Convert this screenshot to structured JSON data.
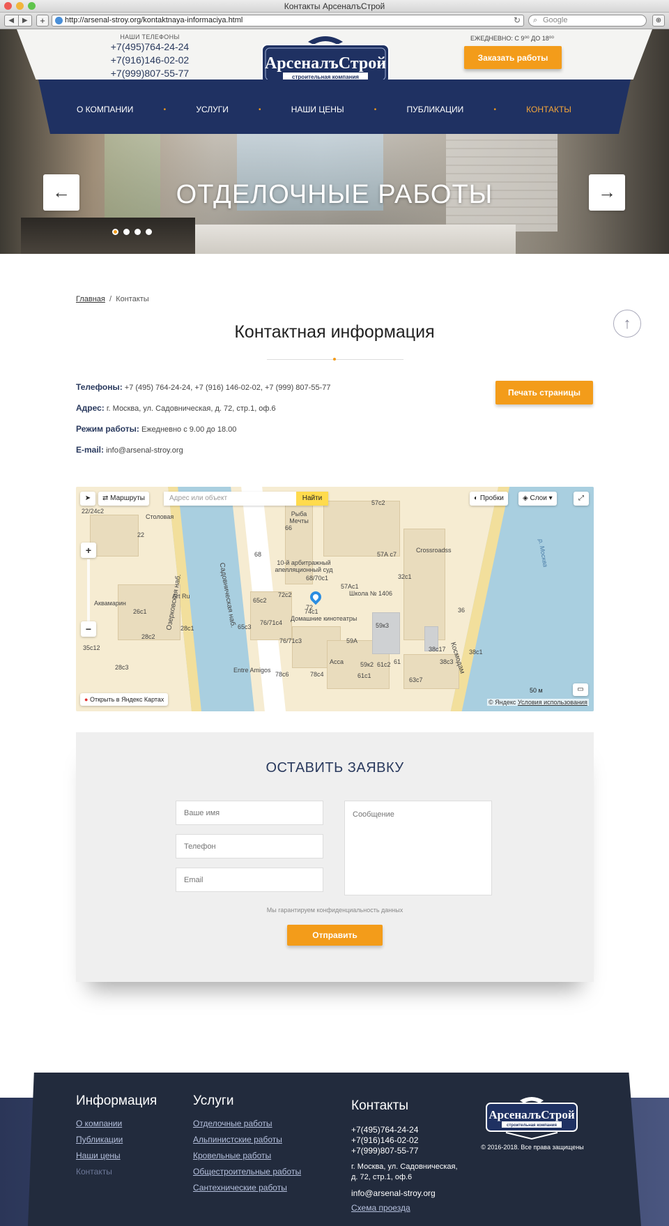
{
  "browser": {
    "window_title": "Контакты АрсеналъСтрой",
    "url": "http://arsenal-stroy.org/kontaktnaya-informaciya.html",
    "search_placeholder": "Google"
  },
  "header": {
    "phones_label": "НАШИ ТЕЛЕФОНЫ",
    "phones": [
      "+7(495)764-24-24",
      "+7(916)146-02-02",
      "+7(999)807-55-77"
    ],
    "logo_text": "АрсеналъСтрой",
    "logo_subtitle": "строительная компания",
    "schedule": "ЕЖЕДНЕВНО: С 9⁰⁰ ДО 18⁰⁰",
    "order_button": "Заказать работы"
  },
  "nav": {
    "items": [
      "О КОМПАНИИ",
      "УСЛУГИ",
      "НАШИ ЦЕНЫ",
      "ПУБЛИКАЦИИ",
      "КОНТАКТЫ"
    ],
    "active": "КОНТАКТЫ"
  },
  "slider": {
    "title": "ОТДЕЛОЧНЫЕ РАБОТЫ",
    "prev_icon": "arrow-left-icon",
    "next_icon": "arrow-right-icon",
    "dots_count": 4,
    "active_dot": 1
  },
  "breadcrumb": {
    "home": "Главная",
    "separator": "/",
    "current": "Контакты"
  },
  "page": {
    "title": "Контактная информация",
    "phones_label": "Телефоны:",
    "phones_value": "+7 (495) 764-24-24, +7 (916) 146-02-02, +7 (999) 807-55-77",
    "address_label": "Адрес:",
    "address_value": "г. Москва, ул. Садовническая, д. 72, стр.1, оф.6",
    "hours_label": "Режим работы:",
    "hours_value": "Ежедневно с 9.00 до 18.00",
    "email_label": "E-mail:",
    "email_value": "info@arsenal-stroy.org",
    "print_button": "Печать страницы"
  },
  "map": {
    "routes_button": "Маршруты",
    "search_placeholder": "Адрес или объект",
    "find_button": "Найти",
    "traffic_button": "Пробки",
    "layers_button": "Слои",
    "open_in_yandex": "Открыть в Яндекс Картах",
    "scale": "50 м",
    "copyright": "© Яндекс",
    "terms": "Условия использования",
    "labels": {
      "l1": "22/24с2",
      "l2": "Столовая",
      "l3": "22",
      "l4": "66",
      "l5": "68",
      "l6": "10-й арбитражный апелляционный суд",
      "l7": "Садовническая наб.",
      "l8": "Озерковская наб.",
      "l9": "68/70с1",
      "l10": "72с2",
      "l11": "65с2",
      "l12": "Art Ru",
      "l13": "Аквамарин",
      "l14": "26с1",
      "l15": "28с1",
      "l16": "28с2",
      "l17": "35с12",
      "l18": "28с3",
      "l19": "74с1",
      "l20": "Домашние кинотеатры",
      "l21": "76/71с4",
      "l22": "65с3",
      "l23": "76/71с3",
      "l24": "Entre Amigos",
      "l25": "78с6",
      "l26": "78с4",
      "l27": "Асса",
      "l28": "61с1",
      "l29": "61с2",
      "l30": "59А",
      "l31": "59к2",
      "l32": "61",
      "l33": "57с2",
      "l34": "57А с7",
      "l35": "Crossroadss",
      "l36": "32с1",
      "l37": "57Ас1",
      "l38": "Школа № 1406",
      "l39": "59к3",
      "l40": "36",
      "l41": "38с17",
      "l42": "38с1",
      "l43": "38с3",
      "l44": "63с7",
      "l45": "р. Москва",
      "l46": "Космодам",
      "l47": "Рыба Мечты",
      "l48": "72"
    }
  },
  "form": {
    "title": "ОСТАВИТЬ ЗАЯВКУ",
    "name_placeholder": "Ваше имя",
    "phone_placeholder": "Телефон",
    "email_placeholder": "Email",
    "message_placeholder": "Сообщение",
    "privacy": "Мы гарантируем конфиденциальность данных",
    "submit": "Отправить"
  },
  "footer": {
    "info_title": "Информация",
    "info_links": [
      "О компании",
      "Публикации",
      "Наши цены",
      "Контакты"
    ],
    "services_title": "Услуги",
    "services_links": [
      "Отделочные работы",
      "Альпинистские работы",
      "Кровельные работы",
      "Общестроительные работы",
      "Сантехнические работы"
    ],
    "contacts_title": "Контакты",
    "phones": [
      "+7(495)764-24-24",
      "+7(916)146-02-02",
      "+7(999)807-55-77"
    ],
    "address_line1": "г. Москва, ул. Садовническая,",
    "address_line2": "д. 72, стр.1, оф.6",
    "email": "info@arsenal-stroy.org",
    "map_link": "Схема проезда",
    "copyright": "© 2016-2018. Все права защищены"
  },
  "colors": {
    "accent": "#f39c1a",
    "navy": "#1f3162",
    "footer": "#222b3d"
  }
}
